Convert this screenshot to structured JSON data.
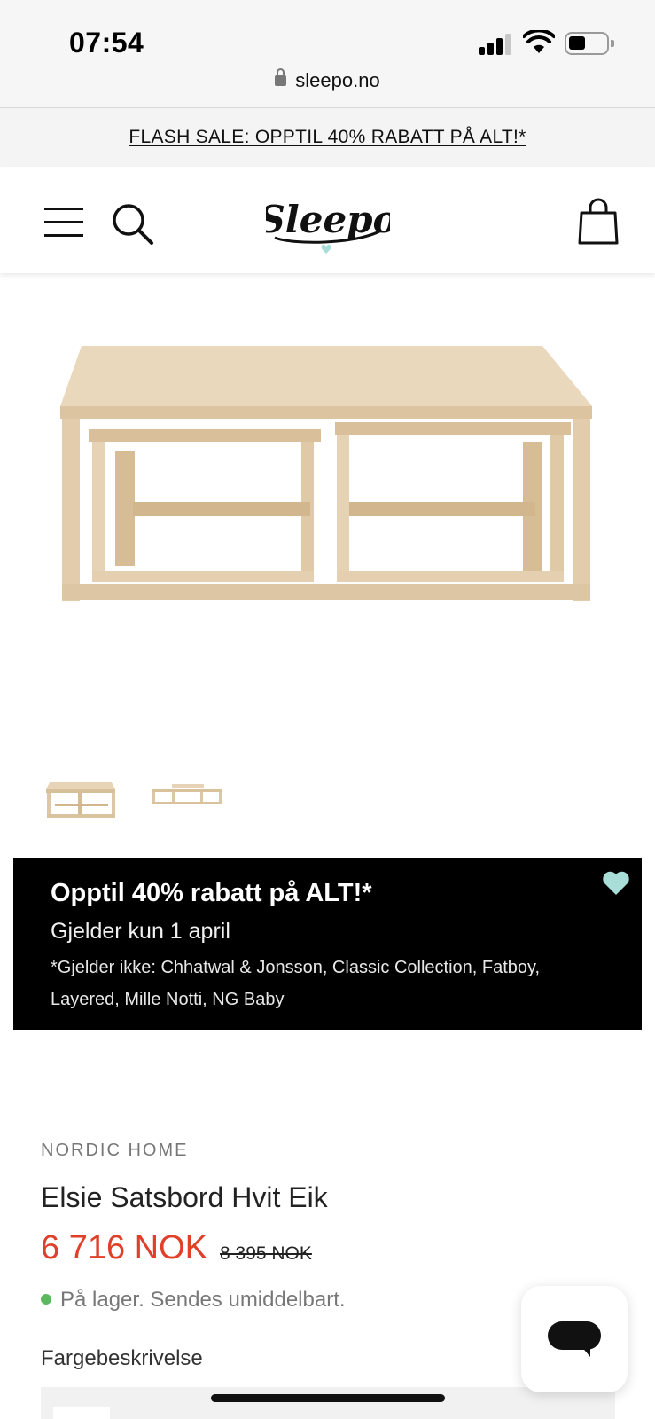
{
  "status_bar": {
    "time": "07:54",
    "url": "sleepo.no"
  },
  "flash_banner": {
    "text": "FLASH SALE: OPPTIL 40% RABATT PÅ ALT!*"
  },
  "header": {
    "logo_text": "Sleepo",
    "icons": [
      "menu-icon",
      "search-icon",
      "shopping-bag-icon"
    ]
  },
  "promo": {
    "headline": "Opptil 40% rabatt på ALT!*",
    "subline": "Gjelder kun 1 april",
    "note": "*Gjelder ikke: Chhatwal & Jonsson, Classic Collection, Fatboy, Layered, Mille Notti, NG Baby"
  },
  "product": {
    "brand": "NORDIC HOME",
    "title": "Elsie Satsbord Hvit Eik",
    "price": "6 716 NOK",
    "old_price": "8 395 NOK",
    "stock": "På lager. Sendes umiddelbart.",
    "color_label": "Fargebeskrivelse"
  },
  "colors": {
    "price": "#e0402a",
    "stock_dot": "#5cb85c",
    "heart": "#a8ddd8",
    "wood": "#e4cfb0"
  }
}
